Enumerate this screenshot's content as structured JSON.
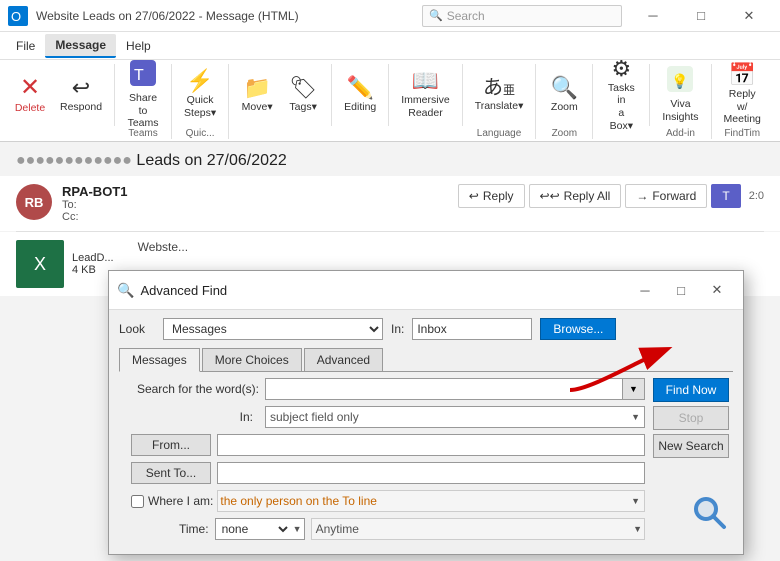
{
  "titlebar": {
    "title": "Website Leads on 27/06/2022 - Message (HTML)",
    "search_placeholder": "Search"
  },
  "menubar": {
    "items": [
      "File",
      "Message",
      "Help"
    ]
  },
  "ribbon": {
    "groups": [
      {
        "label": "",
        "buttons": [
          {
            "id": "delete",
            "icon": "✕",
            "label": "Delete",
            "has_arrow": true
          },
          {
            "id": "respond",
            "icon": "↩",
            "label": "Respond",
            "has_arrow": true
          }
        ]
      },
      {
        "label": "Teams",
        "buttons": [
          {
            "id": "share-teams",
            "icon": "👥",
            "label": "Share to\nTeams",
            "has_arrow": false
          }
        ]
      },
      {
        "label": "Quic...",
        "buttons": [
          {
            "id": "quick-steps",
            "icon": "⚡",
            "label": "Quick\nSteps",
            "has_arrow": true
          }
        ]
      },
      {
        "label": "",
        "buttons": [
          {
            "id": "move",
            "icon": "📁",
            "label": "Move",
            "has_arrow": true
          },
          {
            "id": "tags",
            "icon": "🏷",
            "label": "Tags",
            "has_arrow": true
          }
        ]
      },
      {
        "label": "",
        "buttons": [
          {
            "id": "editing",
            "icon": "✏️",
            "label": "Editing",
            "has_arrow": true
          }
        ]
      },
      {
        "label": "",
        "buttons": [
          {
            "id": "immersive",
            "icon": "📖",
            "label": "Immersive\nReader",
            "has_arrow": true
          }
        ]
      },
      {
        "label": "Language",
        "buttons": [
          {
            "id": "translate",
            "icon": "あ",
            "label": "Translate",
            "has_arrow": true
          }
        ]
      },
      {
        "label": "Zoom",
        "buttons": [
          {
            "id": "zoom",
            "icon": "🔍",
            "label": "Zoom",
            "has_arrow": false
          }
        ]
      },
      {
        "label": "",
        "buttons": [
          {
            "id": "tasks-in-box",
            "icon": "⚙",
            "label": "Tasks in\na Box",
            "has_arrow": true
          }
        ]
      },
      {
        "label": "Add-in",
        "buttons": [
          {
            "id": "viva-insights",
            "icon": "💡",
            "label": "Viva\nInsights",
            "has_arrow": false
          }
        ]
      },
      {
        "label": "FindTim",
        "buttons": [
          {
            "id": "reply-meeting",
            "icon": "📅",
            "label": "Reply w/\nMeeting",
            "has_arrow": false
          }
        ]
      }
    ]
  },
  "email": {
    "subject": "Leads on 27/06/2022",
    "sender_name": "RPA-BOT1",
    "sender_initials": "RB",
    "to": "To:",
    "cc": "Cc:",
    "time": "2:0",
    "attachment_name": "LeadD...",
    "attachment_size": "4 KB",
    "email_preview": "Webste...",
    "actions": {
      "reply_label": "Reply",
      "reply_all_label": "Reply All",
      "forward_label": "Forward"
    }
  },
  "dialog": {
    "title": "Advanced Find",
    "look_label": "Look",
    "look_value": "Messages",
    "in_label": "In:",
    "in_value": "Inbox",
    "browse_label": "Browse...",
    "tabs": [
      "Messages",
      "More Choices",
      "Advanced"
    ],
    "active_tab": "Messages",
    "search_words_label": "Search for the word(s):",
    "search_words_value": "",
    "in_field_label": "In:",
    "in_field_value": "subject field only",
    "from_label": "From...",
    "sent_to_label": "Sent To...",
    "where_label": "Where I am:",
    "where_value": "the only person on the To line",
    "time_label": "Time:",
    "time_value": "none",
    "time_range": "Anytime",
    "find_now_label": "Find Now",
    "stop_label": "Stop",
    "new_search_label": "New Search"
  }
}
